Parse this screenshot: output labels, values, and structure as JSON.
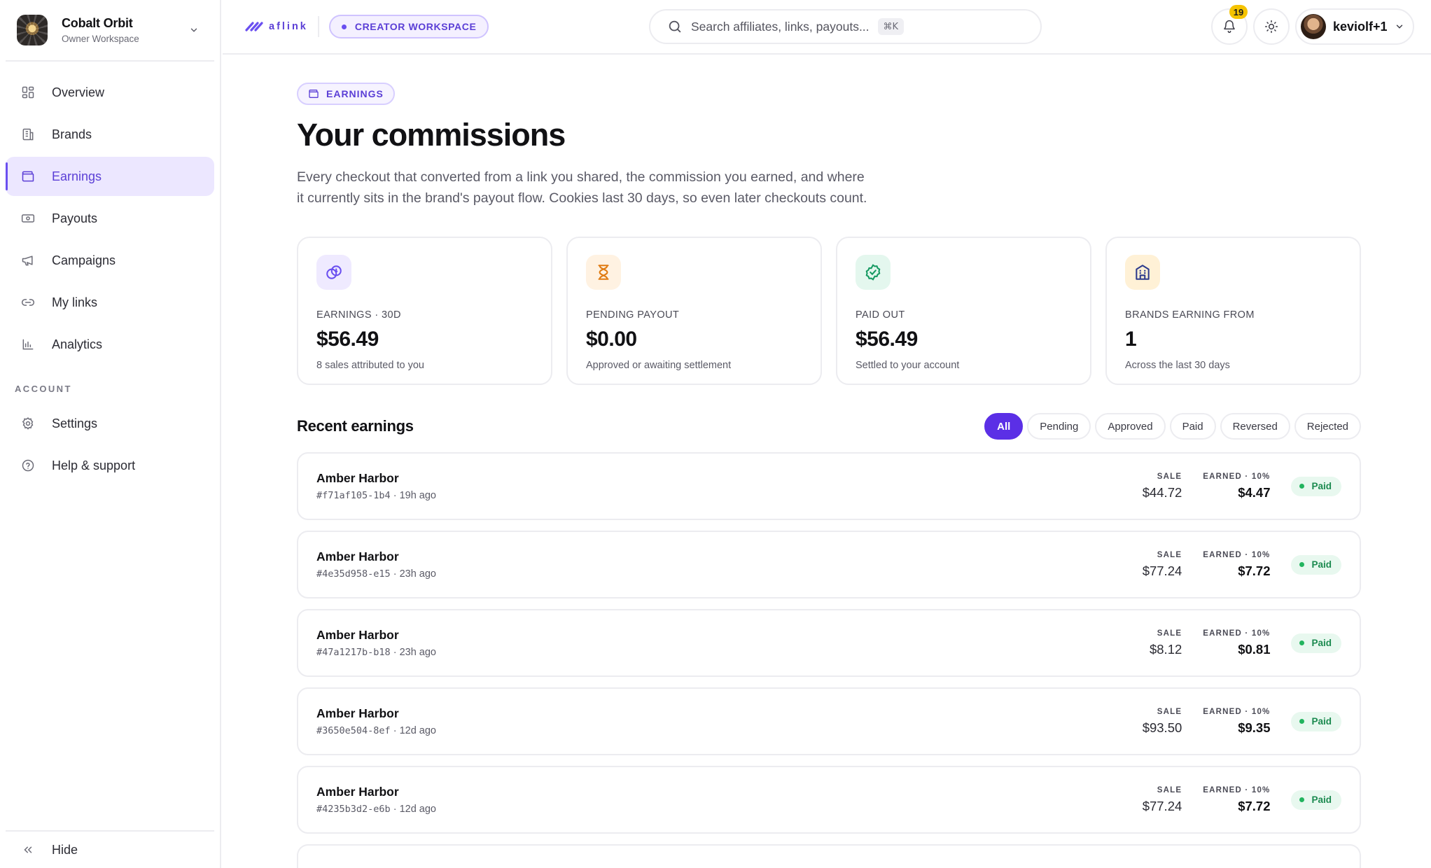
{
  "workspace": {
    "name": "Cobalt Orbit",
    "role": "Owner Workspace"
  },
  "nav": {
    "items": [
      {
        "label": "Overview",
        "icon": "grid-icon"
      },
      {
        "label": "Brands",
        "icon": "building-icon"
      },
      {
        "label": "Earnings",
        "icon": "wallet-icon",
        "active": true
      },
      {
        "label": "Payouts",
        "icon": "banknote-icon"
      },
      {
        "label": "Campaigns",
        "icon": "megaphone-icon"
      },
      {
        "label": "My links",
        "icon": "link-icon"
      },
      {
        "label": "Analytics",
        "icon": "bar-chart-icon"
      }
    ],
    "section_account": "ACCOUNT",
    "account_items": [
      {
        "label": "Settings",
        "icon": "gear-icon"
      },
      {
        "label": "Help & support",
        "icon": "help-circle-icon"
      }
    ],
    "hide_label": "Hide"
  },
  "topbar": {
    "brand": "aflink",
    "workspace_pill": "CREATOR WORKSPACE",
    "search_placeholder": "Search affiliates, links, payouts...",
    "search_shortcut": "⌘K",
    "notifications_count": "19",
    "user_name": "keviolf+1"
  },
  "page": {
    "eyebrow": "EARNINGS",
    "title": "Your commissions",
    "lead": "Every checkout that converted from a link you shared, the commission you earned, and where it currently sits in the brand's payout flow. Cookies last 30 days, so even later checkouts count."
  },
  "stats": [
    {
      "label": "EARNINGS · 30D",
      "value": "$56.49",
      "sub": "8 sales attributed to you",
      "icon": "coins-icon",
      "color": "#6a4ff0",
      "bg": "#efeaff"
    },
    {
      "label": "PENDING PAYOUT",
      "value": "$0.00",
      "sub": "Approved or awaiting settlement",
      "icon": "hourglass-icon",
      "color": "#e07b12",
      "bg": "#fff2e2"
    },
    {
      "label": "PAID OUT",
      "value": "$56.49",
      "sub": "Settled to your account",
      "icon": "check-badge-icon",
      "color": "#169a62",
      "bg": "#e4f7ee"
    },
    {
      "label": "BRANDS EARNING FROM",
      "value": "1",
      "sub": "Across the last 30 days",
      "icon": "store-icon",
      "color": "#2c3a8c",
      "bg": "#fff1d6"
    }
  ],
  "recent": {
    "title": "Recent earnings",
    "filters": [
      "All",
      "Pending",
      "Approved",
      "Paid",
      "Reversed",
      "Rejected"
    ],
    "active_filter": "All",
    "sale_label": "SALE",
    "earned_label": "EARNED · 10%",
    "rows": [
      {
        "brand": "Amber Harbor",
        "id": "#f71af105-1b4",
        "ago": "19h ago",
        "sale": "$44.72",
        "earned": "$4.47",
        "status": "Paid"
      },
      {
        "brand": "Amber Harbor",
        "id": "#4e35d958-e15",
        "ago": "23h ago",
        "sale": "$77.24",
        "earned": "$7.72",
        "status": "Paid"
      },
      {
        "brand": "Amber Harbor",
        "id": "#47a1217b-b18",
        "ago": "23h ago",
        "sale": "$8.12",
        "earned": "$0.81",
        "status": "Paid"
      },
      {
        "brand": "Amber Harbor",
        "id": "#3650e504-8ef",
        "ago": "12d ago",
        "sale": "$93.50",
        "earned": "$9.35",
        "status": "Paid"
      },
      {
        "brand": "Amber Harbor",
        "id": "#4235b3d2-e6b",
        "ago": "12d ago",
        "sale": "$77.24",
        "earned": "$7.72",
        "status": "Paid"
      }
    ]
  }
}
